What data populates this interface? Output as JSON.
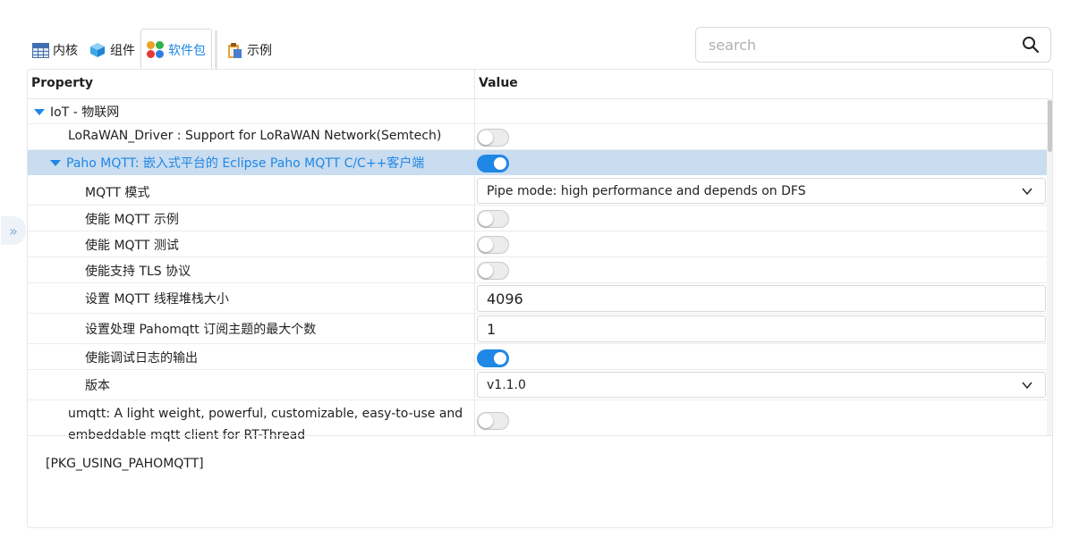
{
  "tabs": [
    {
      "label": "内核",
      "icon": "kernel-table-icon"
    },
    {
      "label": "组件",
      "icon": "component-cube-icon"
    },
    {
      "label": "软件包",
      "icon": "package-dots-icon",
      "active": true
    },
    {
      "label": "示例",
      "icon": "example-clipboard-icon"
    }
  ],
  "search": {
    "placeholder": "search",
    "icon": "search-icon"
  },
  "table": {
    "col_property": "Property",
    "col_value": "Value",
    "rows": [
      {
        "label": "IoT - 物联网"
      },
      {
        "label": "LoRaWAN_Driver : Support for LoRaWAN Network(Semtech)",
        "toggle": "off"
      },
      {
        "label": "Paho MQTT: 嵌入式平台的 Eclipse Paho MQTT C/C++客户端",
        "toggle": "on"
      },
      {
        "label": "MQTT 模式",
        "select": "Pipe mode: high performance and depends on DFS"
      },
      {
        "label": "使能 MQTT 示例",
        "toggle": "off"
      },
      {
        "label": "使能 MQTT 测试",
        "toggle": "off"
      },
      {
        "label": "使能支持 TLS 协议",
        "toggle": "off"
      },
      {
        "label": "设置 MQTT 线程堆栈大小",
        "input": "4096"
      },
      {
        "label": "设置处理 Pahomqtt 订阅主题的最大个数",
        "input": "1"
      },
      {
        "label": "使能调试日志的输出",
        "toggle": "on"
      },
      {
        "label": "版本",
        "select": "v1.1.0"
      },
      {
        "label_line1": "umqtt: A light weight, powerful, customizable, easy-to-use and",
        "label_line2": "embeddable mqtt client for RT-Thread",
        "toggle": "off"
      }
    ]
  },
  "description": "[PKG_USING_PAHOMQTT]",
  "colors": {
    "accent": "#1f87e5",
    "selected_row": "#c9dcf0"
  }
}
